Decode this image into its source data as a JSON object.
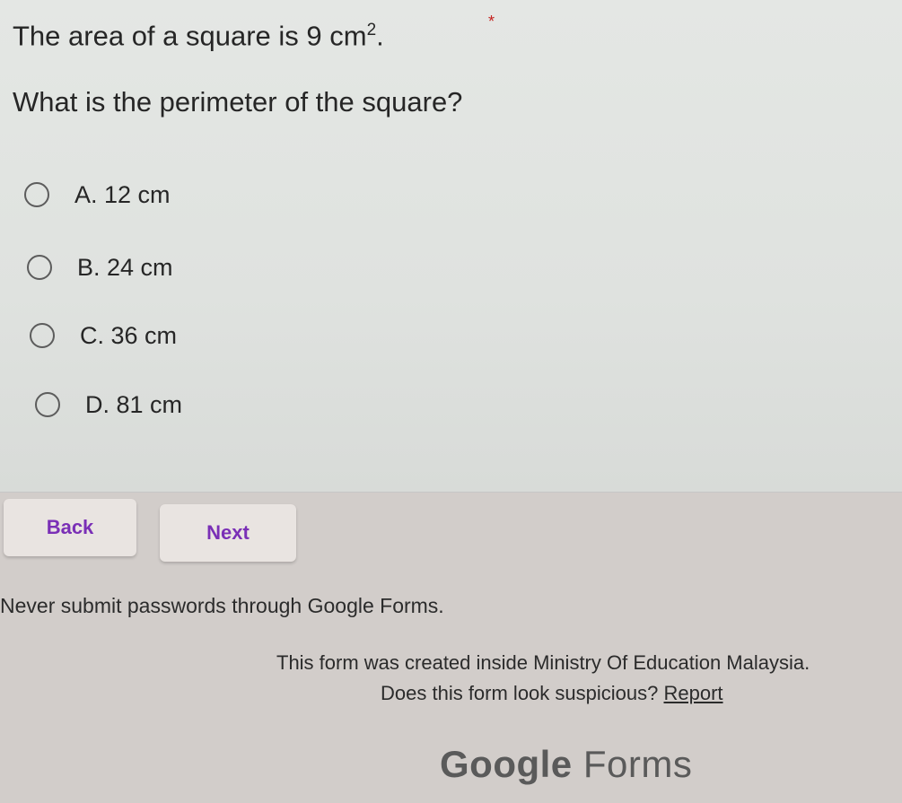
{
  "question": {
    "text_prefix": "The area of a square is 9 cm",
    "superscript": "2",
    "text_suffix": ".",
    "required_mark": "*",
    "prompt": "What is the perimeter of the square?"
  },
  "options": [
    {
      "label": "A. 12 cm",
      "selected": false
    },
    {
      "label": "B. 24 cm",
      "selected": false
    },
    {
      "label": "C. 36 cm",
      "selected": false
    },
    {
      "label": "D. 81 cm",
      "selected": false
    }
  ],
  "nav": {
    "back_label": "Back",
    "next_label": "Next"
  },
  "footer": {
    "password_notice": "Never submit passwords through Google Forms.",
    "created_inside": "This form was created inside Ministry Of Education Malaysia.",
    "suspicious_text": "Does this form look suspicious?",
    "report_label": "Report",
    "brand_google": "Google",
    "brand_forms": "Forms"
  },
  "colors": {
    "accent": "#7a2fb6",
    "required": "#c5221f"
  },
  "icons": {
    "radio": "radio-unchecked-icon"
  }
}
